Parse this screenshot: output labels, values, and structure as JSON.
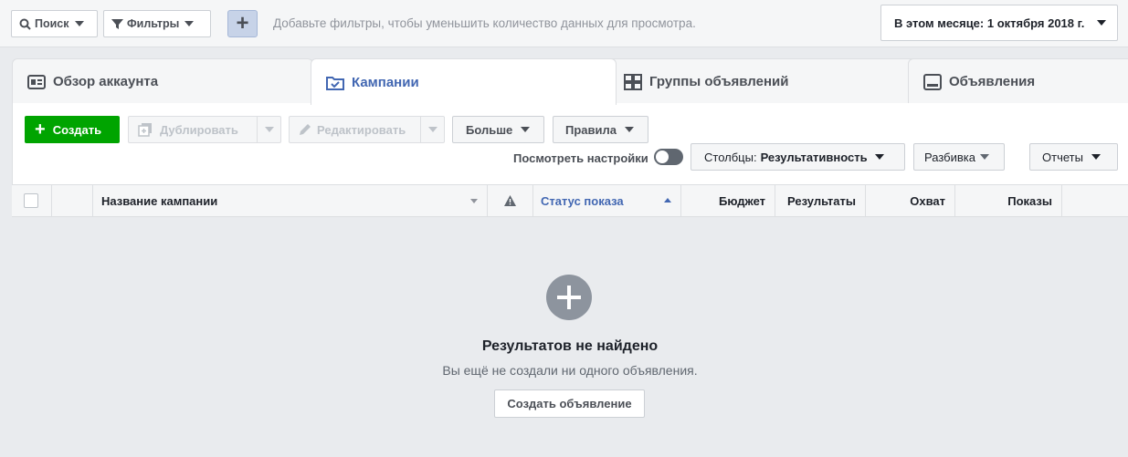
{
  "topbar": {
    "search_label": "Поиск",
    "filters_label": "Фильтры",
    "add_filter_symbol": "+",
    "hint": "Добавьте фильтры, чтобы уменьшить количество данных для просмотра.",
    "date_range": "В этом месяце: 1 октября 2018 г."
  },
  "tabs": [
    {
      "label": "Обзор аккаунта",
      "icon": "account-overview-icon",
      "active": false
    },
    {
      "label": "Кампании",
      "icon": "folder-check-icon",
      "active": true
    },
    {
      "label": "Группы объявлений",
      "icon": "grid-icon",
      "active": false
    },
    {
      "label": "Объявления",
      "icon": "ad-icon",
      "active": false
    }
  ],
  "toolbar": {
    "create_label": "Создать",
    "duplicate_label": "Дублировать",
    "edit_label": "Редактировать",
    "more_label": "Больше",
    "rules_label": "Правила",
    "view_settings_label": "Посмотреть настройки",
    "columns_prefix": "Столбцы:",
    "columns_value": "Результативность",
    "breakdown_label": "Разбивка",
    "reports_label": "Отчеты"
  },
  "table": {
    "headers": {
      "name": "Название кампании",
      "delivery": "Статус показа",
      "budget": "Бюджет",
      "results": "Результаты",
      "reach": "Охват",
      "impressions": "Показы"
    }
  },
  "empty_state": {
    "title": "Результатов не найдено",
    "subtitle": "Вы ещё не создали ни одного объявления.",
    "button": "Создать объявление"
  },
  "colors": {
    "accent": "#4267b2",
    "create_green": "#00a400",
    "background": "#e9ebee"
  }
}
